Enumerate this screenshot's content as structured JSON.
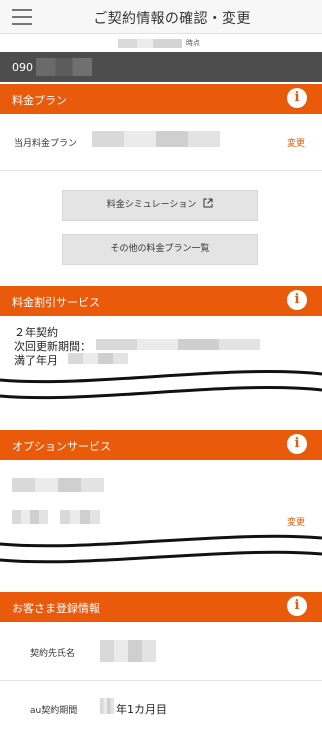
{
  "header": {
    "title": "ご契約情報の確認・変更",
    "timestamp_suffix": "時点"
  },
  "phone": {
    "number_prefix": "090"
  },
  "plan": {
    "section_title": "料金プラン",
    "current_plan_label": "当月料金プラン",
    "change_label": "変更",
    "simulation_button": "料金シミュレーション",
    "other_plans_button": "その他の料金プラン一覧"
  },
  "discount": {
    "section_title": "料金割引サービス",
    "contract_type": "２年契約",
    "renewal_label": "次回更新期間：",
    "expiry_label": "満了年月"
  },
  "options": {
    "section_title": "オプションサービス",
    "change_label": "変更"
  },
  "registration": {
    "section_title": "お客さま登録情報",
    "name_label": "契約先氏名",
    "period_label": "au契約期間",
    "period_value": "年1カ月目"
  },
  "colors": {
    "accent": "#ea5a0b",
    "phone_bar": "#4d4d4d"
  }
}
